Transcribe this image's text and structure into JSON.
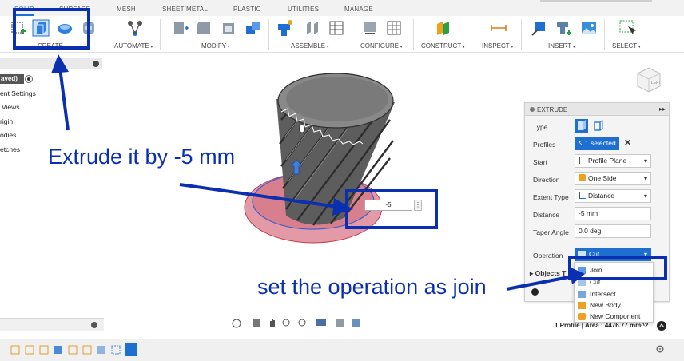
{
  "tabs": [
    "SOLID",
    "SURFACE",
    "MESH",
    "SHEET METAL",
    "PLASTIC",
    "UTILITIES",
    "MANAGE"
  ],
  "toolbar_groups": [
    "CREATE",
    "AUTOMATE",
    "MODIFY",
    "ASSEMBLE",
    "CONFIGURE",
    "CONSTRUCT",
    "INSPECT",
    "INSERT",
    "SELECT"
  ],
  "browser": {
    "unsaved": "aved)",
    "rows": [
      "ent Settings",
      "Views",
      "rigin",
      "odies",
      "etches"
    ]
  },
  "extrude_panel": {
    "title": "EXTRUDE",
    "type_label": "Type",
    "profiles_label": "Profiles",
    "profiles_value": "1 selected",
    "start_label": "Start",
    "start_value": "Profile Plane",
    "direction_label": "Direction",
    "direction_value": "One Side",
    "extent_label": "Extent Type",
    "extent_value": "Distance",
    "distance_label": "Distance",
    "distance_value": "-5 mm",
    "taper_label": "Taper Angle",
    "taper_value": "0.0 deg",
    "operation_label": "Operation",
    "operation_value": "Cut",
    "objects_label": "Objects T"
  },
  "operation_menu": [
    "Join",
    "Cut",
    "Intersect",
    "New Body",
    "New Component"
  ],
  "distance_input": "-5",
  "status_text": "1 Profile | Area : 4476.77 mm^2",
  "annotations": {
    "extrude": "Extrude it  by -5 mm",
    "operation": "set the operation as join"
  },
  "colors": {
    "accent_blue": "#1f6fd1",
    "annotation_blue": "#0a2fb0",
    "body_gray": "#6b6b6b",
    "profile_red": "#e0707a"
  }
}
